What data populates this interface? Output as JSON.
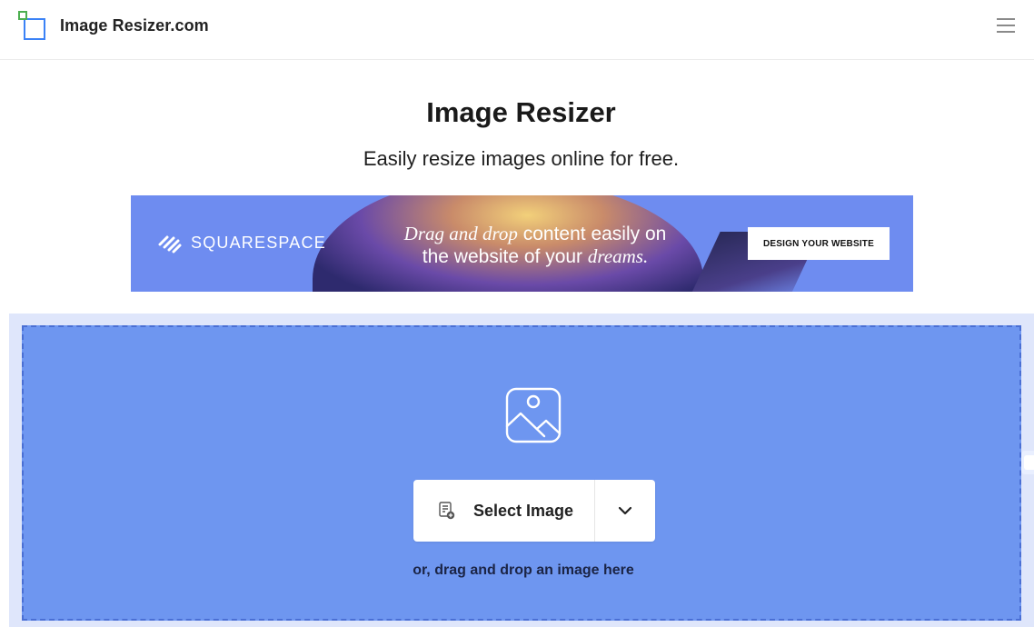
{
  "header": {
    "site_name": "Image Resizer.com",
    "menu_icon": "hamburger-menu-icon"
  },
  "hero": {
    "title": "Image Resizer",
    "subtitle": "Easily resize images online for free."
  },
  "ad": {
    "brand": "SQUARESPACE",
    "tagline_italic_1": "Drag and drop",
    "tagline_regular_1": " content easily on",
    "tagline_regular_2": "the website of your ",
    "tagline_italic_2": "dreams.",
    "cta_label": "DESIGN YOUR WEBSITE"
  },
  "upload": {
    "placeholder_icon": "image-placeholder-icon",
    "select_button_label": "Select Image",
    "select_button_icon": "file-add-icon",
    "dropdown_icon": "chevron-down-icon",
    "drop_hint": "or, drag and drop an image here"
  },
  "colors": {
    "drop_zone_bg": "#6e96f0",
    "drop_zone_border": "#4a6fd4",
    "ad_bg": "#6e8cf0",
    "logo_blue": "#3b82f6",
    "logo_green": "#4caf50"
  }
}
